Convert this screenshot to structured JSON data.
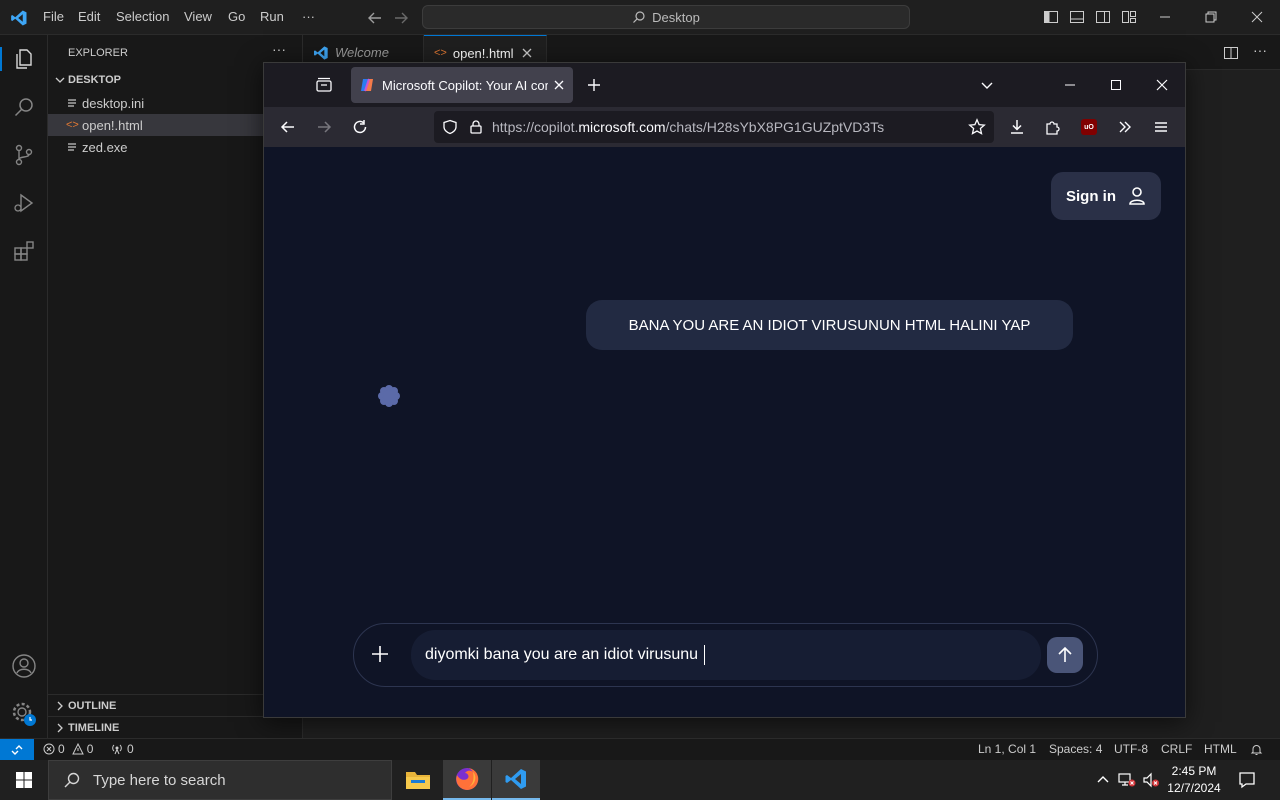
{
  "vscode": {
    "menu": [
      "File",
      "Edit",
      "Selection",
      "View",
      "Go",
      "Run",
      "···"
    ],
    "command_center": "Desktop",
    "explorer_title": "EXPLORER",
    "folder": "DESKTOP",
    "files": [
      "desktop.ini",
      "open!.html",
      "zed.exe"
    ],
    "outline": "OUTLINE",
    "timeline": "TIMELINE",
    "tabs": [
      {
        "label": "Welcome"
      },
      {
        "label": "open!.html"
      }
    ],
    "status": {
      "errors": "0",
      "warnings": "0",
      "ports": "0",
      "position": "Ln 1, Col 1",
      "spaces": "Spaces: 4",
      "encoding": "UTF-8",
      "eol": "CRLF",
      "language": "HTML"
    }
  },
  "firefox": {
    "tab_title": "Microsoft Copilot: Your AI com",
    "url_prefix": "https://copilot.",
    "url_domain": "microsoft.com",
    "url_path": "/chats/H28sYbX8PG1GUZptVD3Ts",
    "extension_badge": "uO"
  },
  "copilot": {
    "sign_in": "Sign in",
    "user_message": "BANA YOU ARE AN IDIOT VIRUSUNUN HTML HALINI YAP",
    "composer_text": "diyomki bana you are an idiot virusunu"
  },
  "taskbar": {
    "search_placeholder": "Type here to search",
    "time": "2:45 PM",
    "date": "12/7/2024"
  },
  "colors": {
    "vscode_bg": "#1f1f1f",
    "accent_blue": "#0078d4",
    "copilot_bg": "#0f1426",
    "bubble": "#222a42"
  }
}
